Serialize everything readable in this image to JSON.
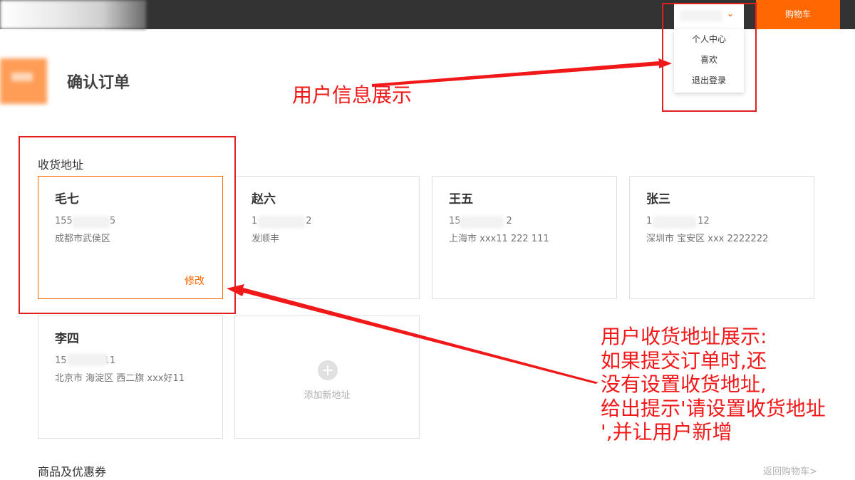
{
  "header": {
    "cart_label": "购物车",
    "dropdown_indicator": "chevron-down-icon",
    "user_menu": [
      "个人中心",
      "喜欢",
      "退出登录"
    ]
  },
  "page": {
    "title": "确认订单"
  },
  "address_section": {
    "title": "收货地址",
    "cards": [
      {
        "name": "毛七",
        "phone_prefix": "155",
        "phone_suffix": "5",
        "address": "成都市武侯区",
        "edit_label": "修改",
        "selected": true
      },
      {
        "name": "赵六",
        "phone_prefix": "1",
        "phone_suffix": "2",
        "address": "发顺丰"
      },
      {
        "name": "王五",
        "phone_prefix": "15",
        "phone_suffix": "2",
        "address": "上海市 xxx11 222 111"
      },
      {
        "name": "张三",
        "phone_prefix": "1",
        "phone_suffix": "12",
        "address": "深圳市 宝安区 xxx 2222222"
      },
      {
        "name": "李四",
        "phone_prefix": "15",
        "phone_suffix": "11",
        "address": "北京市 海淀区 西二旗 xxx好11"
      }
    ],
    "add_label": "添加新地址"
  },
  "goods_section": {
    "title": "商品及优惠券",
    "back_link": "返回购物车>"
  },
  "annotations": {
    "user_info": "用户信息展示",
    "address_lines": [
      "用户收货地址展示:",
      "如果提交订单时,还",
      "没有设置收货地址,",
      "给出提示'请设置收货地址",
      "',并让用户新增"
    ],
    "color": "#f01818"
  },
  "colors": {
    "accent": "#ff6700",
    "topbar": "#333333"
  }
}
